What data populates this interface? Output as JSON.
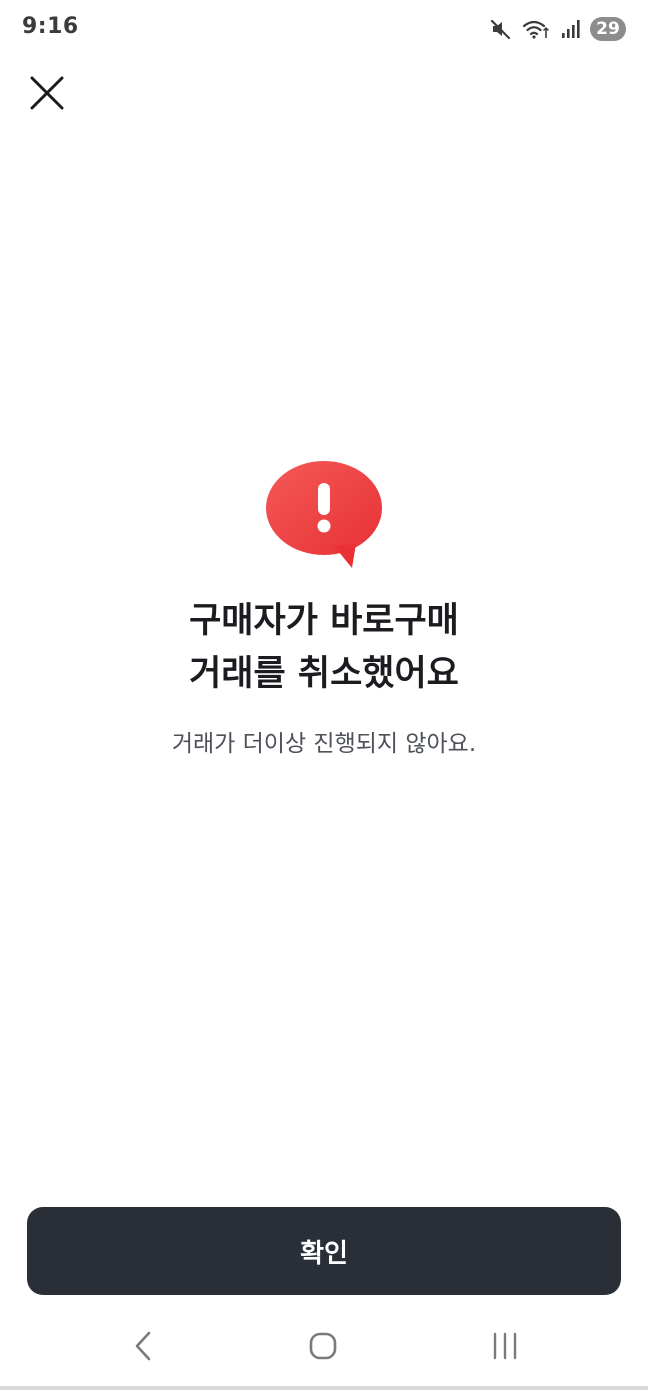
{
  "status_bar": {
    "time": "9:16",
    "battery": "29",
    "icons": [
      "mute-icon",
      "wifi-icon",
      "signal-icon",
      "battery-icon"
    ]
  },
  "dialog": {
    "title_line1": "구매자가 바로구매",
    "title_line2": "거래를 취소했어요",
    "message": "거래가 더이상 진행되지 않아요.",
    "confirm_label": "확인",
    "alert_icon": "exclamation-speech-bubble-icon",
    "close_icon": "close-icon"
  },
  "colors": {
    "alert_red": "#ef3b3b",
    "button_bg": "#2a2f37",
    "title_text": "#1a1c20",
    "message_text": "#4d5159"
  },
  "nav_bar": {
    "icons": [
      "back-icon",
      "home-icon",
      "recents-icon"
    ]
  }
}
